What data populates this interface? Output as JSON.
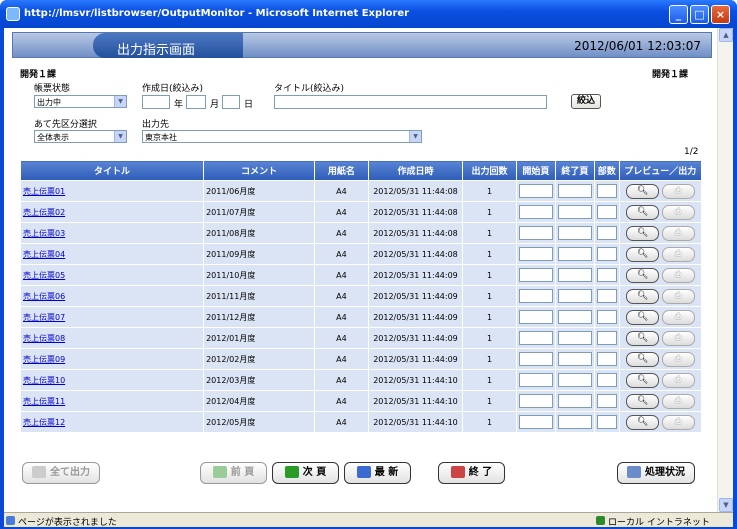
{
  "window": {
    "title": "http://lmsvr/listbrowser/OutputMonitor - Microsoft Internet Explorer"
  },
  "header": {
    "title": "出力指示画面",
    "datetime": "2012/06/01 12:03:07"
  },
  "user": {
    "dept_left": "開発１課",
    "dept_right": "開発１課"
  },
  "filters": {
    "status_label": "帳票状態",
    "status_value": "出力中",
    "date_label": "作成日(絞込み)",
    "year_label": "年",
    "month_label": "月",
    "day_label": "日",
    "title_label": "タイトル(絞込み)",
    "search_button": "絞込",
    "dest_type_label": "あて先区分選択",
    "dest_type_value": "全体表示",
    "dest_label": "出力先",
    "dest_value": "東京本社"
  },
  "paging": {
    "indicator": "1/2"
  },
  "table": {
    "headers": [
      "タイトル",
      "コメント",
      "用紙名",
      "作成日時",
      "出力回数",
      "開始頁",
      "終了頁",
      "部数",
      "プレビュー／出力"
    ],
    "rows": [
      {
        "title": "売上伝票01",
        "comment": "2011/06月度",
        "paper": "A4",
        "created": "2012/05/31 11:44:08",
        "count": "1"
      },
      {
        "title": "売上伝票02",
        "comment": "2011/07月度",
        "paper": "A4",
        "created": "2012/05/31 11:44:08",
        "count": "1"
      },
      {
        "title": "売上伝票03",
        "comment": "2011/08月度",
        "paper": "A4",
        "created": "2012/05/31 11:44:08",
        "count": "1"
      },
      {
        "title": "売上伝票04",
        "comment": "2011/09月度",
        "paper": "A4",
        "created": "2012/05/31 11:44:08",
        "count": "1"
      },
      {
        "title": "売上伝票05",
        "comment": "2011/10月度",
        "paper": "A4",
        "created": "2012/05/31 11:44:09",
        "count": "1"
      },
      {
        "title": "売上伝票06",
        "comment": "2011/11月度",
        "paper": "A4",
        "created": "2012/05/31 11:44:09",
        "count": "1"
      },
      {
        "title": "売上伝票07",
        "comment": "2011/12月度",
        "paper": "A4",
        "created": "2012/05/31 11:44:09",
        "count": "1"
      },
      {
        "title": "売上伝票08",
        "comment": "2012/01月度",
        "paper": "A4",
        "created": "2012/05/31 11:44:09",
        "count": "1"
      },
      {
        "title": "売上伝票09",
        "comment": "2012/02月度",
        "paper": "A4",
        "created": "2012/05/31 11:44:09",
        "count": "1"
      },
      {
        "title": "売上伝票10",
        "comment": "2012/03月度",
        "paper": "A4",
        "created": "2012/05/31 11:44:10",
        "count": "1"
      },
      {
        "title": "売上伝票11",
        "comment": "2012/04月度",
        "paper": "A4",
        "created": "2012/05/31 11:44:10",
        "count": "1"
      },
      {
        "title": "売上伝票12",
        "comment": "2012/05月度",
        "paper": "A4",
        "created": "2012/05/31 11:44:10",
        "count": "1"
      }
    ]
  },
  "actions": {
    "all_output": "全て出力",
    "prev": "前 頁",
    "next": "次 頁",
    "latest": "最 新",
    "exit": "終 了",
    "process_status": "処理状況"
  },
  "statusbar": {
    "left": "ページが表示されました",
    "right": "ローカル イントラネット"
  },
  "icons": {
    "preview": "magnifier-icon",
    "print": "printer-icon"
  }
}
